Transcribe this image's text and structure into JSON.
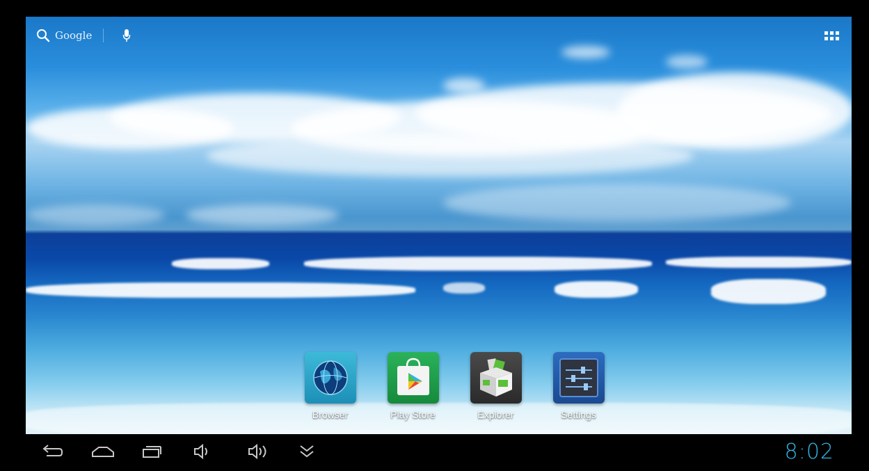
{
  "search": {
    "label": "Google",
    "icon": "search-icon",
    "mic_icon": "microphone-icon"
  },
  "apps_button": {
    "icon": "apps-grid-icon"
  },
  "dock": {
    "apps": [
      {
        "label": "Browser",
        "icon": "globe-icon",
        "color": "#2aa0c8"
      },
      {
        "label": "Play Store",
        "icon": "play-store-bag-icon",
        "color": "#1f9e4a"
      },
      {
        "label": "Explorer",
        "icon": "box-icon",
        "color": "#3a3a3a"
      },
      {
        "label": "Settings",
        "icon": "sliders-icon",
        "color": "#2b5fa8"
      }
    ]
  },
  "nav_bar": {
    "buttons": [
      {
        "name": "back",
        "icon": "back-arrow-icon"
      },
      {
        "name": "home",
        "icon": "home-icon"
      },
      {
        "name": "recent-apps",
        "icon": "recent-apps-icon"
      },
      {
        "name": "volume-down",
        "icon": "volume-down-icon"
      },
      {
        "name": "volume-up",
        "icon": "volume-up-icon"
      },
      {
        "name": "notifications",
        "icon": "double-chevron-down-icon"
      }
    ],
    "clock": "8:02"
  },
  "colors": {
    "clock": "#33b5e5",
    "nav_icon": "#c8c8c8"
  }
}
